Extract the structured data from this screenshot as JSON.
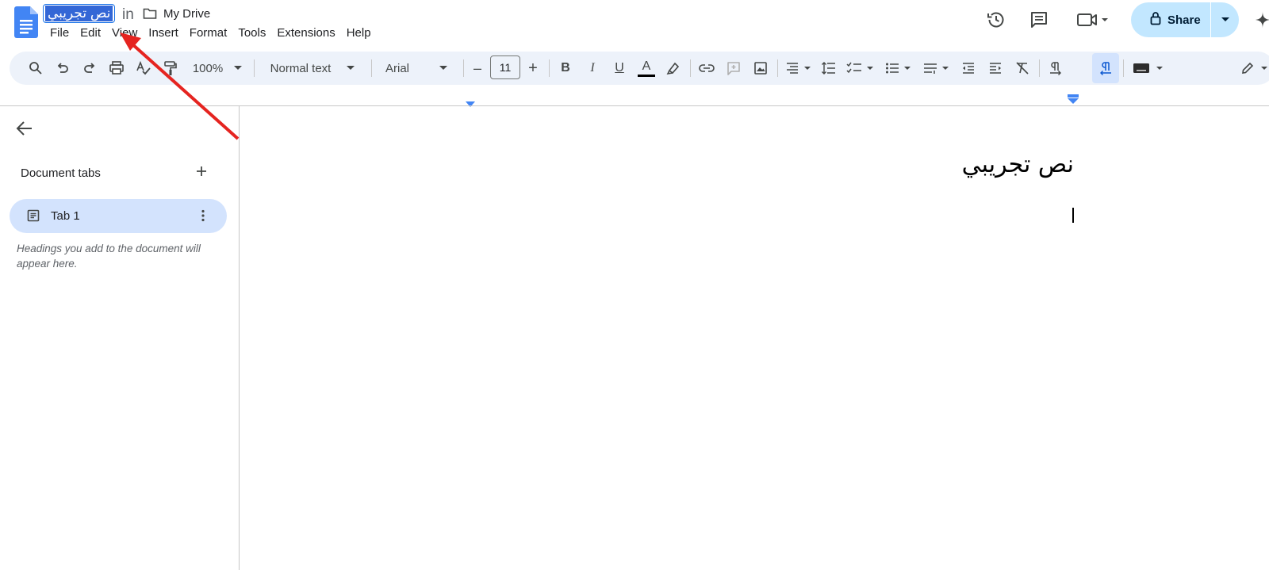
{
  "header": {
    "doc_title": "نص تجريبي",
    "in_label": "in",
    "folder": "My Drive",
    "menu": [
      "File",
      "Edit",
      "View",
      "Insert",
      "Format",
      "Tools",
      "Extensions",
      "Help"
    ],
    "share_label": "Share",
    "icons": [
      "history-icon",
      "comment-icon",
      "meet-video-icon",
      "lock-icon",
      "gemini-sparkle-icon"
    ]
  },
  "toolbar": {
    "zoom": "100%",
    "style": "Normal text",
    "font": "Arial",
    "font_size": "11",
    "minus": "–",
    "plus": "+"
  },
  "sidebar": {
    "section_label": "Document tabs",
    "tabs": [
      {
        "label": "Tab 1"
      }
    ],
    "hint": "Headings you add to the document will appear here."
  },
  "document": {
    "content": "نص تجريبي"
  },
  "colors": {
    "accent": "#1a73e8",
    "toolbar_bg": "#edf2fa",
    "tab_active_bg": "#d3e3fd",
    "share_bg": "#c2e7ff",
    "annotation_arrow": "#e52420"
  }
}
